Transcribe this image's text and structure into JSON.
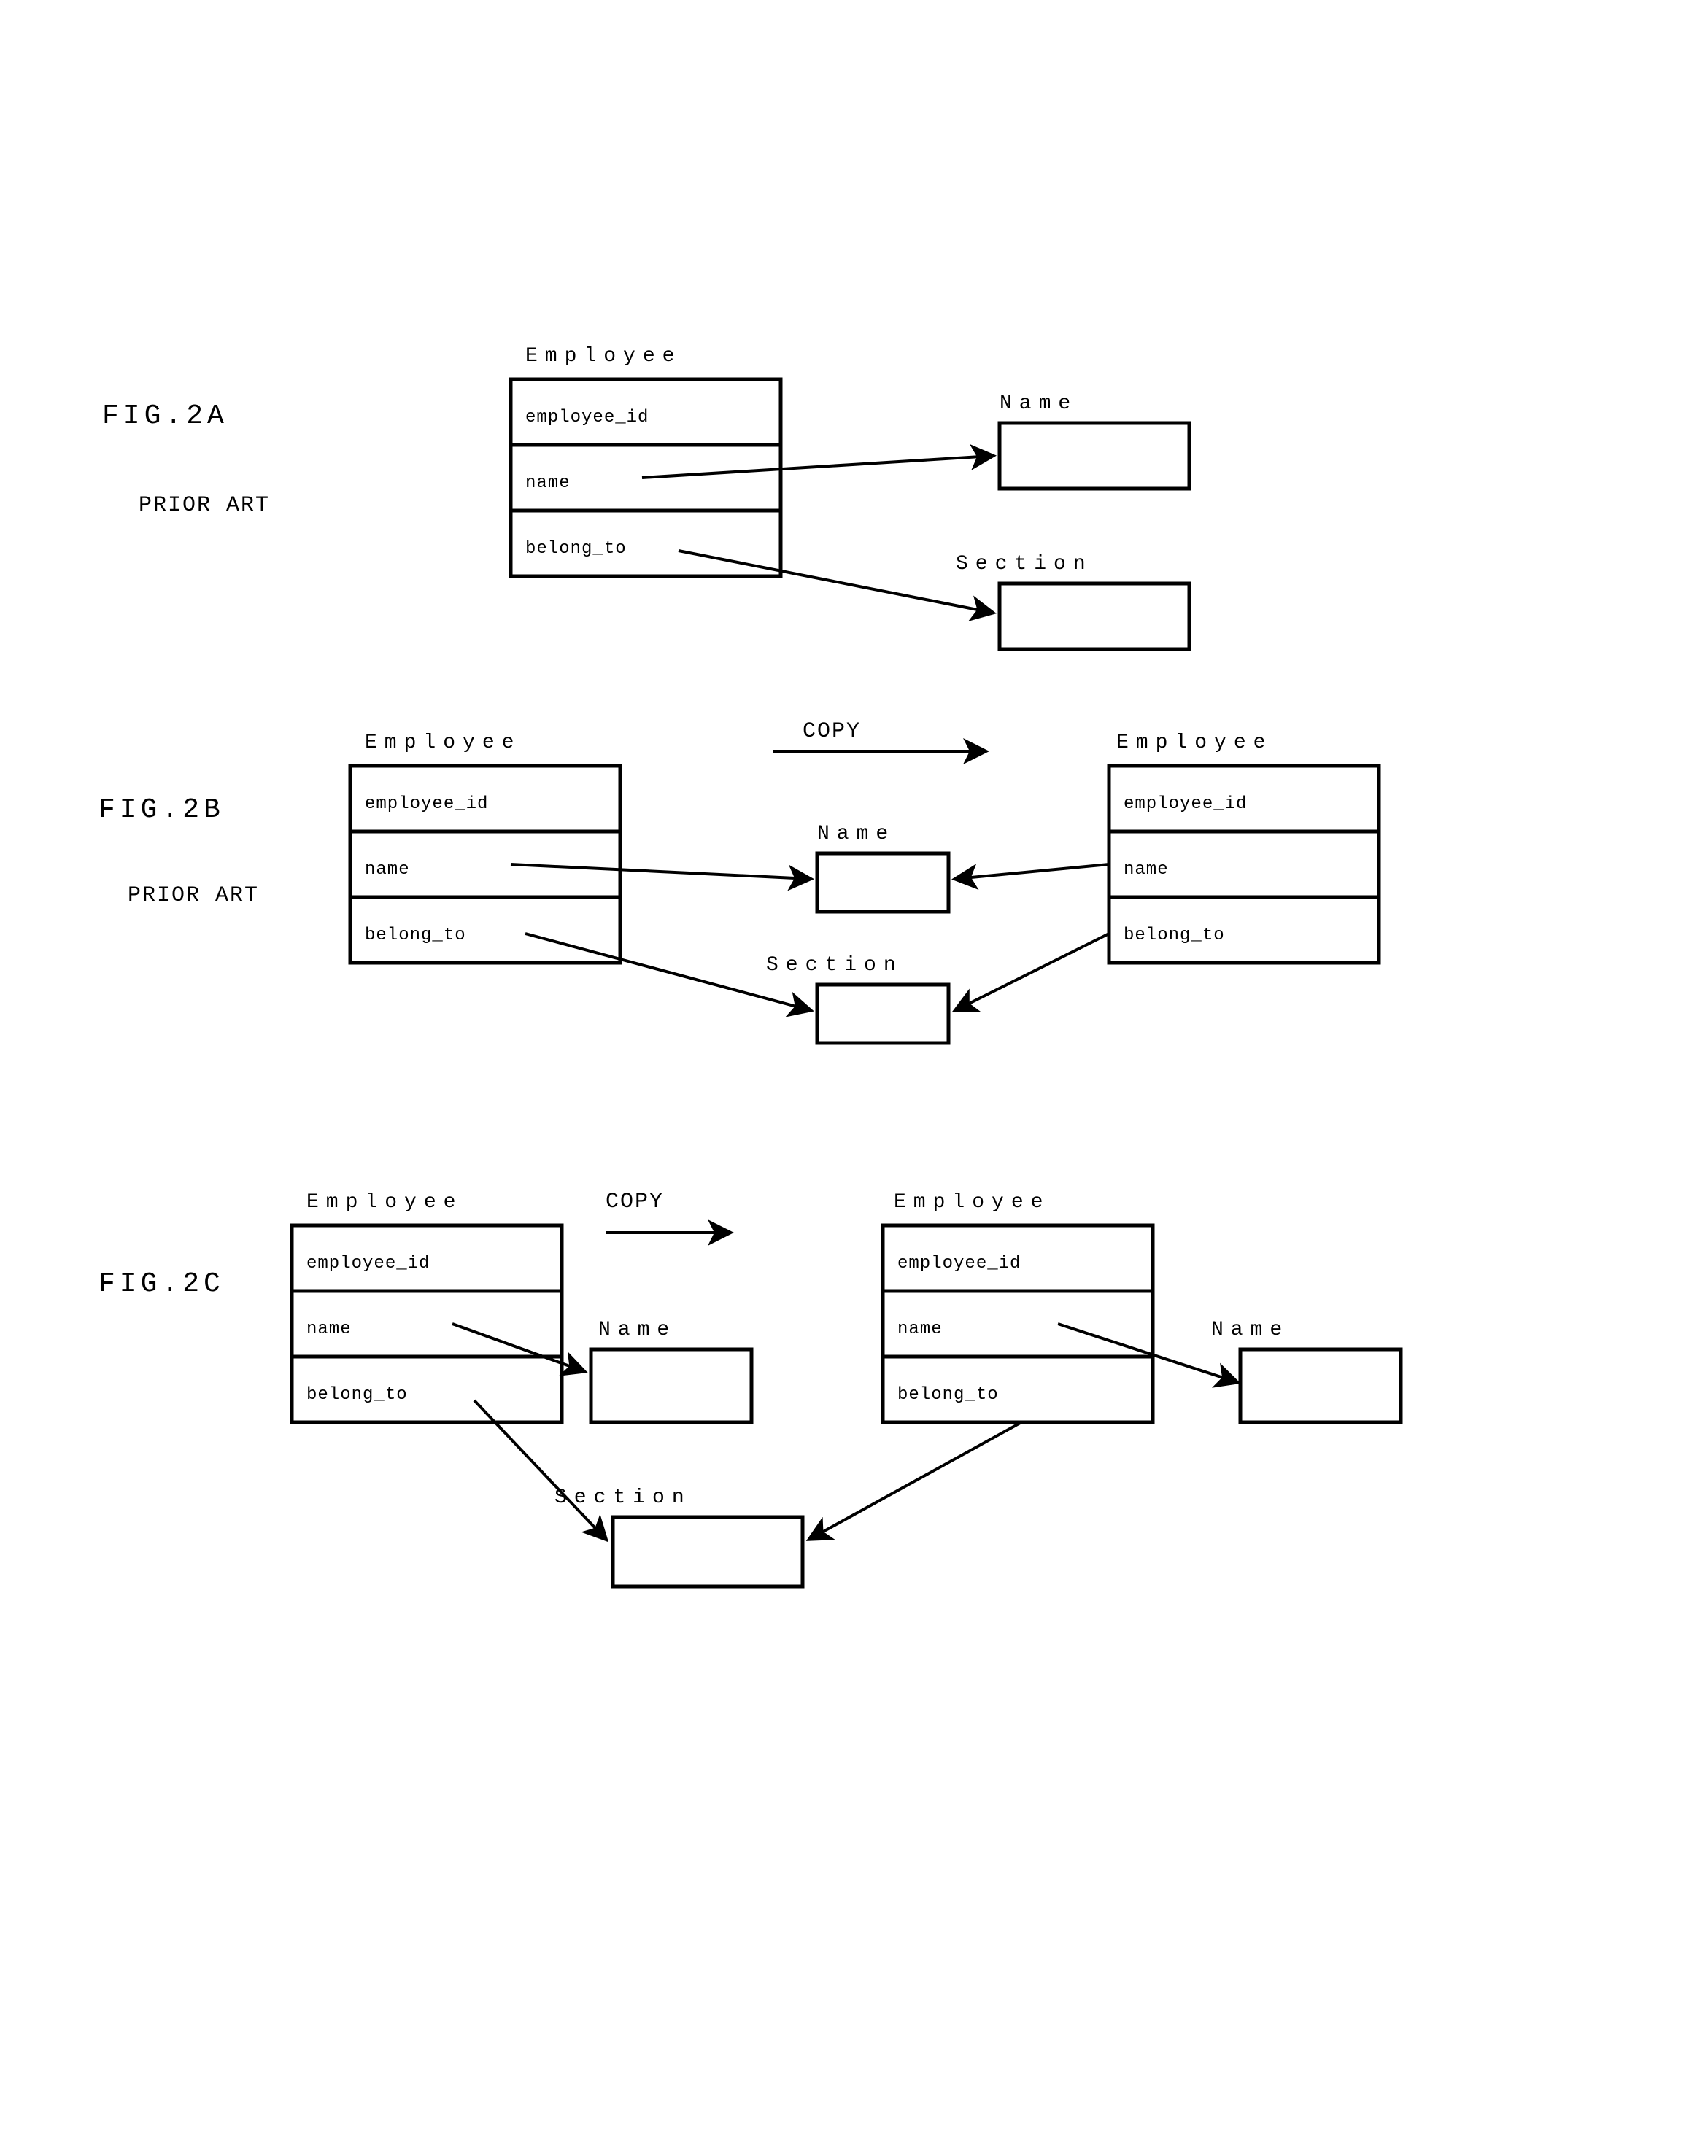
{
  "figA": {
    "label": "FIG.2A",
    "sub": "PRIOR ART",
    "employee_title": "Employee",
    "rows": [
      "employee_id",
      "name",
      "belong_to"
    ],
    "right1_title": "Name",
    "right2_title": "Section"
  },
  "figB": {
    "label": "FIG.2B",
    "sub": "PRIOR ART",
    "copy": "COPY",
    "left_title": "Employee",
    "left_rows": [
      "employee_id",
      "name",
      "belong_to"
    ],
    "right_title": "Employee",
    "right_rows": [
      "employee_id",
      "name",
      "belong_to"
    ],
    "mid1_title": "Name",
    "mid2_title": "Section"
  },
  "figC": {
    "label": "FIG.2C",
    "copy": "COPY",
    "left_title": "Employee",
    "left_rows": [
      "employee_id",
      "name",
      "belong_to"
    ],
    "right_title": "Employee",
    "right_rows": [
      "employee_id",
      "name",
      "belong_to"
    ],
    "name1_title": "Name",
    "name2_title": "Name",
    "section_title": "Section"
  }
}
